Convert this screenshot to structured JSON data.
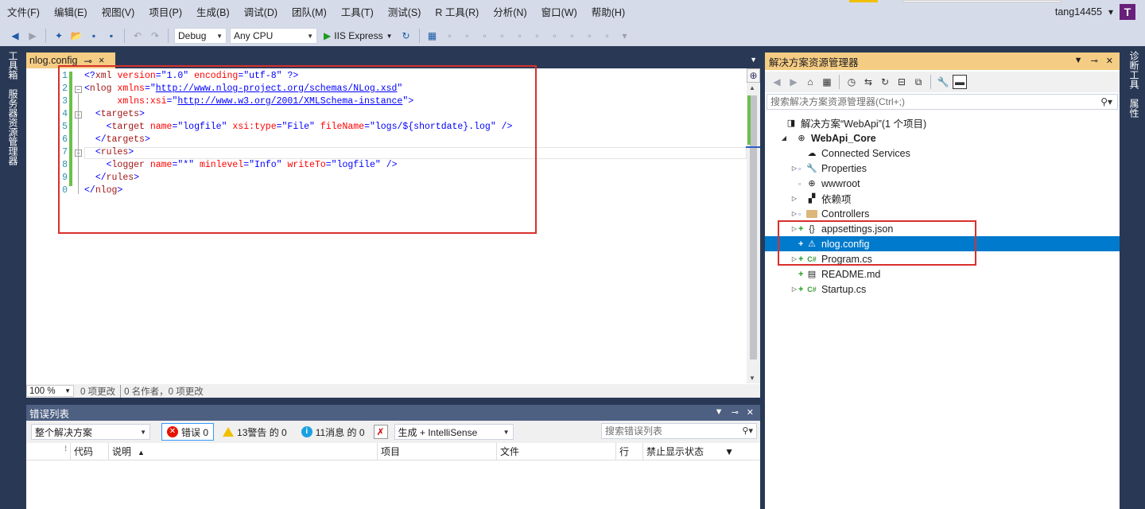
{
  "menu": [
    "文件(F)",
    "编辑(E)",
    "视图(V)",
    "项目(P)",
    "生成(B)",
    "调试(D)",
    "团队(M)",
    "工具(T)",
    "测试(S)",
    "R 工具(R)",
    "分析(N)",
    "窗口(W)",
    "帮助(H)"
  ],
  "account": {
    "name": "tang14455",
    "dropdown": "▾",
    "avatar": "T"
  },
  "toolbar": {
    "config": "Debug",
    "platform": "Any CPU",
    "run_label": "IIS Express"
  },
  "left_tabs": [
    "工具箱",
    "服务器资源管理器"
  ],
  "right_tabs": [
    "诊断工具",
    "属性"
  ],
  "editor": {
    "tab_title": "nlog.config",
    "pin": "⊸",
    "close": "×",
    "lines": [
      {
        "no": "1",
        "indent": "",
        "parts": [
          {
            "t": "bracket",
            "v": "<?"
          },
          {
            "t": "tag",
            "v": "xml"
          },
          {
            "t": "txt",
            "v": " "
          },
          {
            "t": "attr",
            "v": "version"
          },
          {
            "t": "bracket",
            "v": "=\""
          },
          {
            "t": "val",
            "v": "1.0"
          },
          {
            "t": "bracket",
            "v": "\""
          },
          {
            "t": "txt",
            "v": " "
          },
          {
            "t": "attr",
            "v": "encoding"
          },
          {
            "t": "bracket",
            "v": "=\""
          },
          {
            "t": "val",
            "v": "utf-8"
          },
          {
            "t": "bracket",
            "v": "\""
          },
          {
            "t": "txt",
            "v": " "
          },
          {
            "t": "bracket",
            "v": "?>"
          }
        ]
      },
      {
        "no": "2",
        "indent": "",
        "parts": [
          {
            "t": "bracket",
            "v": "<"
          },
          {
            "t": "tag",
            "v": "nlog"
          },
          {
            "t": "txt",
            "v": " "
          },
          {
            "t": "attr",
            "v": "xmlns"
          },
          {
            "t": "bracket",
            "v": "=\""
          },
          {
            "t": "link",
            "v": "http://www.nlog-project.org/schemas/NLog.xsd"
          },
          {
            "t": "bracket",
            "v": "\""
          }
        ]
      },
      {
        "no": "3",
        "indent": "      ",
        "parts": [
          {
            "t": "attr",
            "v": "xmlns:xsi"
          },
          {
            "t": "bracket",
            "v": "=\""
          },
          {
            "t": "link",
            "v": "http://www.w3.org/2001/XMLSchema-instance"
          },
          {
            "t": "bracket",
            "v": "\">"
          }
        ]
      },
      {
        "no": "4",
        "indent": "  ",
        "parts": [
          {
            "t": "bracket",
            "v": "<"
          },
          {
            "t": "tag",
            "v": "targets"
          },
          {
            "t": "bracket",
            "v": ">"
          }
        ]
      },
      {
        "no": "5",
        "indent": "    ",
        "parts": [
          {
            "t": "bracket",
            "v": "<"
          },
          {
            "t": "tag",
            "v": "target"
          },
          {
            "t": "txt",
            "v": " "
          },
          {
            "t": "attr",
            "v": "name"
          },
          {
            "t": "bracket",
            "v": "=\""
          },
          {
            "t": "val",
            "v": "logfile"
          },
          {
            "t": "bracket",
            "v": "\""
          },
          {
            "t": "txt",
            "v": " "
          },
          {
            "t": "attr",
            "v": "xsi:type"
          },
          {
            "t": "bracket",
            "v": "=\""
          },
          {
            "t": "val",
            "v": "File"
          },
          {
            "t": "bracket",
            "v": "\""
          },
          {
            "t": "txt",
            "v": " "
          },
          {
            "t": "attr",
            "v": "fileName"
          },
          {
            "t": "bracket",
            "v": "=\""
          },
          {
            "t": "val",
            "v": "logs/${shortdate}.log"
          },
          {
            "t": "bracket",
            "v": "\""
          },
          {
            "t": "txt",
            "v": " "
          },
          {
            "t": "bracket",
            "v": "/>"
          }
        ]
      },
      {
        "no": "6",
        "indent": "  ",
        "parts": [
          {
            "t": "bracket",
            "v": "</"
          },
          {
            "t": "tag",
            "v": "targets"
          },
          {
            "t": "bracket",
            "v": ">"
          }
        ]
      },
      {
        "no": "7",
        "indent": "  ",
        "parts": [
          {
            "t": "bracket",
            "v": "<"
          },
          {
            "t": "tag",
            "v": "rules"
          },
          {
            "t": "bracket",
            "v": ">"
          }
        ]
      },
      {
        "no": "8",
        "indent": "    ",
        "parts": [
          {
            "t": "bracket",
            "v": "<"
          },
          {
            "t": "tag",
            "v": "logger"
          },
          {
            "t": "txt",
            "v": " "
          },
          {
            "t": "attr",
            "v": "name"
          },
          {
            "t": "bracket",
            "v": "=\""
          },
          {
            "t": "val",
            "v": "*"
          },
          {
            "t": "bracket",
            "v": "\""
          },
          {
            "t": "txt",
            "v": " "
          },
          {
            "t": "attr",
            "v": "minlevel"
          },
          {
            "t": "bracket",
            "v": "=\""
          },
          {
            "t": "val",
            "v": "Info"
          },
          {
            "t": "bracket",
            "v": "\""
          },
          {
            "t": "txt",
            "v": " "
          },
          {
            "t": "attr",
            "v": "writeTo"
          },
          {
            "t": "bracket",
            "v": "=\""
          },
          {
            "t": "val",
            "v": "logfile"
          },
          {
            "t": "bracket",
            "v": "\""
          },
          {
            "t": "txt",
            "v": " "
          },
          {
            "t": "bracket",
            "v": "/>"
          }
        ]
      },
      {
        "no": "9",
        "indent": "  ",
        "parts": [
          {
            "t": "bracket",
            "v": "</"
          },
          {
            "t": "tag",
            "v": "rules"
          },
          {
            "t": "bracket",
            "v": ">"
          }
        ]
      },
      {
        "no": "0",
        "indent": "",
        "parts": [
          {
            "t": "bracket",
            "v": "</"
          },
          {
            "t": "tag",
            "v": "nlog"
          },
          {
            "t": "bracket",
            "v": ">"
          }
        ]
      }
    ],
    "zoom": "100 %",
    "changes": "0 项更改",
    "authors": "0 名作者，0 项更改"
  },
  "error_list": {
    "title": "错误列表",
    "scope": "整个解决方案",
    "errors_label": "错误 0",
    "warnings_label": "13警告 的 0",
    "messages_label": "11消息 的 0",
    "build_filter": "生成 + IntelliSense",
    "search_placeholder": "搜索错误列表",
    "columns": [
      "代码",
      "说明",
      "项目",
      "文件",
      "行",
      "禁止显示状态"
    ]
  },
  "solution_explorer": {
    "title": "解决方案资源管理器",
    "search_placeholder": "搜索解决方案资源管理器(Ctrl+;)",
    "items": [
      {
        "label": "解决方案“WebApi”(1 个项目)",
        "level": 0,
        "expander": "",
        "prefix": "",
        "icon": "solution-icon",
        "glyph": "◨",
        "bold": false,
        "selected": false
      },
      {
        "label": "WebApi_Core",
        "level": 1,
        "expander": "◢",
        "prefix": "",
        "icon": "project-icon",
        "glyph": "⊕",
        "bold": true,
        "selected": false
      },
      {
        "label": "Connected Services",
        "level": 2,
        "expander": "",
        "prefix": "",
        "icon": "connected-services-icon",
        "glyph": "☁",
        "bold": false,
        "selected": false
      },
      {
        "label": "Properties",
        "level": 2,
        "expander": "▷",
        "prefix": "lock",
        "icon": "wrench-icon",
        "glyph": "🔧",
        "bold": false,
        "selected": false
      },
      {
        "label": "wwwroot",
        "level": 2,
        "expander": "",
        "prefix": "lock",
        "icon": "globe-icon",
        "glyph": "⊕",
        "bold": false,
        "selected": false
      },
      {
        "label": "依赖项",
        "level": 2,
        "expander": "▷",
        "prefix": "",
        "icon": "dependencies-icon",
        "glyph": "▞",
        "bold": false,
        "selected": false
      },
      {
        "label": "Controllers",
        "level": 2,
        "expander": "▷",
        "prefix": "lock",
        "icon": "folder-icon",
        "glyph": "",
        "bold": false,
        "selected": false
      },
      {
        "label": "appsettings.json",
        "level": 2,
        "expander": "▷",
        "prefix": "plus",
        "icon": "json-file-icon",
        "glyph": "{}",
        "bold": false,
        "selected": false
      },
      {
        "label": "nlog.config",
        "level": 2,
        "expander": "",
        "prefix": "plus",
        "icon": "config-file-icon",
        "glyph": "⚠",
        "bold": false,
        "selected": true
      },
      {
        "label": "Program.cs",
        "level": 2,
        "expander": "▷",
        "prefix": "plus",
        "icon": "csharp-file-icon",
        "glyph": "C#",
        "bold": false,
        "selected": false
      },
      {
        "label": "README.md",
        "level": 2,
        "expander": "",
        "prefix": "plus",
        "icon": "markdown-file-icon",
        "glyph": "▤",
        "bold": false,
        "selected": false
      },
      {
        "label": "Startup.cs",
        "level": 2,
        "expander": "▷",
        "prefix": "plus",
        "icon": "csharp-file-icon",
        "glyph": "C#",
        "bold": false,
        "selected": false
      }
    ]
  },
  "colors": {
    "accent": "#007acc",
    "highlight_box": "#d9302c",
    "tab_active": "#f5cc84",
    "chrome": "#293955"
  }
}
